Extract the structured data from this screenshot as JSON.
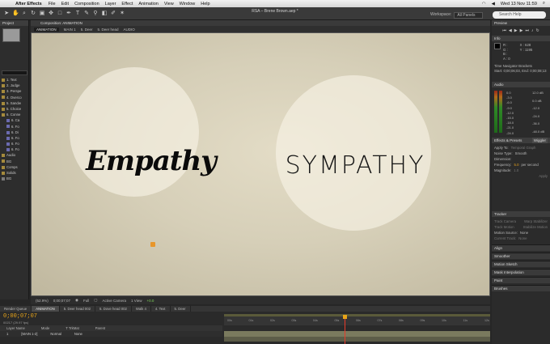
{
  "menubar": {
    "app": "After Effects",
    "items": [
      "File",
      "Edit",
      "Composition",
      "Layer",
      "Effect",
      "Animation",
      "View",
      "Window",
      "Help"
    ],
    "clock": "Wed 13 Nov  11:59"
  },
  "document": {
    "title": "RSA – Brene Brown.aep *"
  },
  "toolbar": {
    "workspace_label": "Workspace:",
    "workspace_value": "All Panels",
    "search_placeholder": "Search Help"
  },
  "project": {
    "tab": "Project",
    "items": [
      {
        "label": "1. Text",
        "color": "#a58a3c"
      },
      {
        "label": "2. Judge",
        "color": "#a58a3c"
      },
      {
        "label": "3. Perspe",
        "color": "#a58a3c"
      },
      {
        "label": "4. Overco",
        "color": "#a58a3c"
      },
      {
        "label": "5. Sandw",
        "color": "#a58a3c"
      },
      {
        "label": "5. Choice",
        "color": "#a58a3c"
      },
      {
        "label": "6. Conne",
        "color": "#a58a3c"
      },
      {
        "label": "6. Ca",
        "color": "#6b6bb0"
      },
      {
        "label": "6. Fo",
        "color": "#6b6bb0"
      },
      {
        "label": "6. Di",
        "color": "#6b6bb0"
      },
      {
        "label": "6. Fo",
        "color": "#6b6bb0"
      },
      {
        "label": "6. Fo",
        "color": "#6b6bb0"
      },
      {
        "label": "6. Fo",
        "color": "#6b6bb0"
      },
      {
        "label": "Audio",
        "color": "#a58a3c"
      },
      {
        "label": "BG",
        "color": "#a58a3c"
      },
      {
        "label": "Comps",
        "color": "#a58a3c"
      },
      {
        "label": "Solids",
        "color": "#a58a3c"
      },
      {
        "label": "BG",
        "color": "#7a7a7a"
      }
    ]
  },
  "composition": {
    "tab": "Composition: ANIMATION",
    "breadcrumbs": [
      "ANIMATION",
      "MAIN 1",
      "5. Deer",
      "5. Deer head",
      "AUDIO"
    ],
    "canvas": {
      "left_word": "Empathy",
      "right_word": "SYMPATHY"
    },
    "viewer_bar": {
      "zoom": "(52.9%)",
      "timecode": "0;00;07;07",
      "resolution": "Full",
      "camera": "Active Camera",
      "views": "1 View",
      "exposure": "+0.0"
    }
  },
  "right": {
    "preview_tab": "Preview",
    "info_tab": "Info",
    "info_lines": [
      "R :",
      "G :",
      "B :",
      "A : 0",
      "X : 628",
      "Y : 1195"
    ],
    "info_note": "Time Navigator Brackets",
    "info_note2": "Start: 0;00;06;03, End: 0;00;08;13",
    "audio_tab": "Audio",
    "audio_left": [
      "0.0",
      "-3.0",
      "-6.0",
      "-9.0",
      "-12.0",
      "-15.0",
      "-18.0",
      "-21.0",
      "-24.0"
    ],
    "audio_right": [
      "12.0 dB",
      "0.0 dB",
      "-12.0",
      "-24.0",
      "-36.0",
      "-48.0 dB"
    ],
    "effects_tab": "Effects & Presets",
    "wiggler_tab": "Wiggler",
    "wiggler": {
      "apply_to_label": "Apply To:",
      "apply_to_value": "Temporal Graph",
      "noise_label": "Noise Type:",
      "noise_value": "Smooth",
      "dimension_label": "Dimension:",
      "frequency_label": "Frequency:",
      "frequency_value": "5.0",
      "frequency_unit": "per second",
      "magnitude_label": "Magnitude:",
      "magnitude_value": "1.0",
      "apply_button": "Apply"
    },
    "tracker_tab": "Tracker",
    "tracker": {
      "track_camera": "Track Camera",
      "warp_stabilizer": "Warp Stabilizer",
      "track_motion": "Track Motion",
      "stabilize_motion": "Stabilize Motion",
      "motion_source_label": "Motion Source:",
      "motion_source_value": "None",
      "current_track_label": "Current Track:",
      "current_track_value": "None"
    },
    "stack": [
      "Align",
      "Smoother",
      "Motion Sketch",
      "Mask Interpolation",
      "Paint",
      "Brushes"
    ]
  },
  "timeline": {
    "tabs": [
      "Render Queue",
      "ANIMATION",
      "5. Deer head 002",
      "5. Dove head 002",
      "Walk 4",
      "4. Text",
      "5. Deer"
    ],
    "timecode": "0;00;07;07",
    "sub": "00217 (29.97 fps)",
    "columns": [
      "Layer Name",
      "Mode",
      "T TrkMat",
      "Parent"
    ],
    "layer": {
      "index": "1",
      "name": "[MAIN 1-2]",
      "mode": "Normal",
      "parent": "None"
    },
    "ticks": [
      "00s",
      "01s",
      "02s",
      "03s",
      "04s",
      "05s",
      "06s",
      "07s",
      "08s",
      "09s",
      "10s",
      "11s",
      "12s"
    ]
  }
}
